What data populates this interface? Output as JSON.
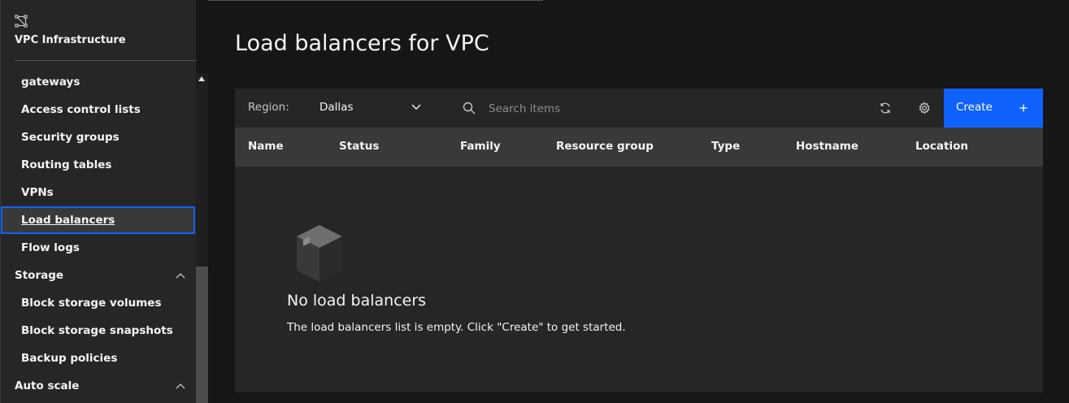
{
  "sidebar": {
    "title": "VPC Infrastructure",
    "items": [
      {
        "label": "gateways"
      },
      {
        "label": "Access control lists"
      },
      {
        "label": "Security groups"
      },
      {
        "label": "Routing tables"
      },
      {
        "label": "VPNs"
      },
      {
        "label": "Load balancers",
        "active": true
      },
      {
        "label": "Flow logs"
      }
    ],
    "sections": {
      "storage": {
        "label": "Storage",
        "items": [
          {
            "label": "Block storage volumes"
          },
          {
            "label": "Block storage snapshots"
          },
          {
            "label": "Backup policies"
          }
        ]
      },
      "autoscale": {
        "label": "Auto scale"
      }
    }
  },
  "page": {
    "title": "Load balancers for VPC"
  },
  "toolbar": {
    "region_label": "Region:",
    "region_value": "Dallas",
    "search_placeholder": "Search items",
    "create_label": "Create"
  },
  "table": {
    "columns": [
      "Name",
      "Status",
      "Family",
      "Resource group",
      "Type",
      "Hostname",
      "Location"
    ]
  },
  "empty_state": {
    "title": "No load balancers",
    "description": "The load balancers list is empty. Click \"Create\" to get started."
  },
  "colors": {
    "accent": "#0f62fe",
    "background": "#161616",
    "panel": "#262626",
    "header": "#393939"
  }
}
